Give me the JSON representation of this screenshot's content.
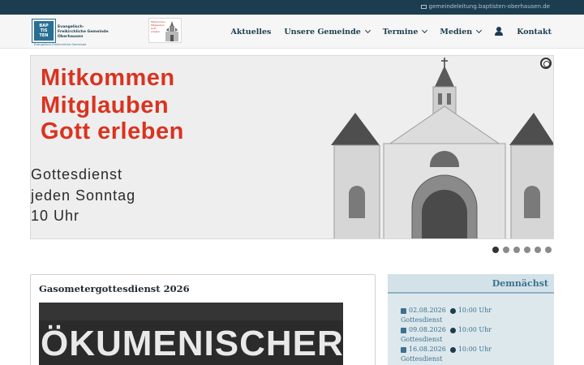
{
  "topbar": {
    "email": "gemeindeleitung.baptisten-oberhausen.de"
  },
  "header": {
    "logo": {
      "mark_lines": [
        "BAP",
        "TIS",
        "TEN"
      ],
      "mark_sub": "Evangelisch-Freikirchliche Gemeinde",
      "name_lines": [
        "Evangelisch-",
        "Freikirchliche Gemeinde",
        "Oberhausen"
      ]
    },
    "poster_logo_text": "Mitkommen Mitglauben Gott erleben"
  },
  "nav": {
    "items": [
      {
        "label": "Aktuelles",
        "dropdown": false
      },
      {
        "label": "Unsere Gemeinde",
        "dropdown": true
      },
      {
        "label": "Termine",
        "dropdown": true
      },
      {
        "label": "Medien",
        "dropdown": true
      }
    ],
    "user_icon": "user-icon",
    "contact": "Kontakt"
  },
  "slider": {
    "headline": [
      "Mitkommen",
      "Mitglauben",
      "Gott erleben"
    ],
    "info": [
      "Gottesdienst",
      "jeden Sonntag",
      "10 Uhr"
    ],
    "slide_count": 6,
    "active_slide": 1
  },
  "article": {
    "title": "Gasometergottesdienst 2026",
    "image_text": "ÖKUMENISCHER"
  },
  "sidebar": {
    "title": "Demnächst",
    "events": [
      {
        "date": "02.08.2026",
        "time": "10:00 Uhr",
        "name": "Gottesdienst"
      },
      {
        "date": "09.08.2026",
        "time": "10:00 Uhr",
        "name": "Gottesdienst"
      },
      {
        "date": "16.08.2026",
        "time": "10:00 Uhr",
        "name": "Gottesdienst"
      }
    ]
  },
  "colors": {
    "topbar": "#1c3d4f",
    "accent": "#3c7290",
    "slider_red": "#d93320"
  }
}
